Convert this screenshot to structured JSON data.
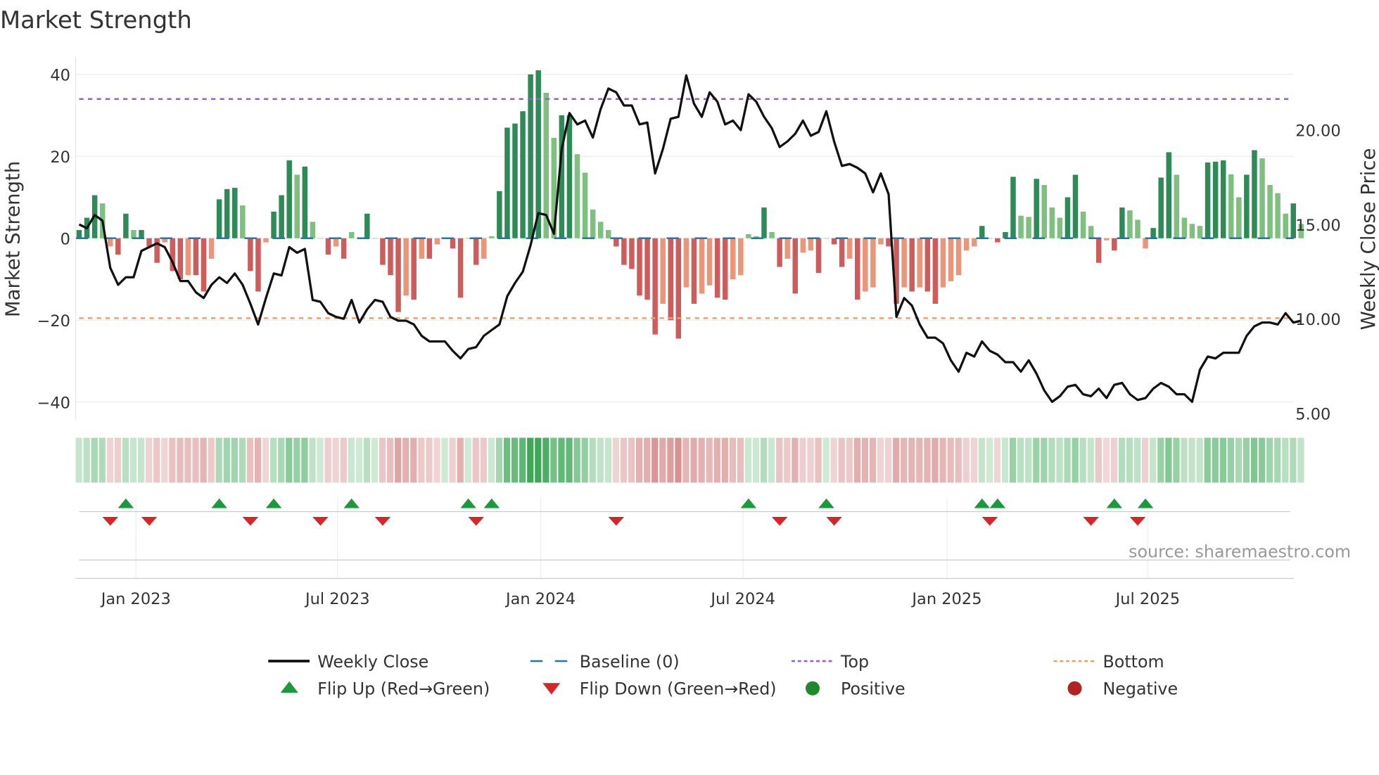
{
  "chart_data": {
    "type": "bar",
    "title": "Market Strength",
    "ylabel": "Market Strength",
    "y2label": "Weekly Close Price",
    "ylim": [
      -44,
      44
    ],
    "y2lim": [
      4.6,
      24.2
    ],
    "yticks": [
      40,
      20,
      0,
      -20,
      -40
    ],
    "ytick_labels": [
      "40",
      "20",
      "0",
      "−20",
      "−40"
    ],
    "y2ticks": [
      20,
      15,
      10,
      5
    ],
    "y2tick_labels": [
      "20.00",
      "15.00",
      "10.00",
      "5.00"
    ],
    "x_unit": "weeks from first bar",
    "xticks": [
      {
        "week": 7.3,
        "label": "Jan 2023"
      },
      {
        "week": 33.2,
        "label": "Jul 2023"
      },
      {
        "week": 59.3,
        "label": "Jan 2024"
      },
      {
        "week": 85.3,
        "label": "Jul 2024"
      },
      {
        "week": 111.5,
        "label": "Jan 2025"
      },
      {
        "week": 137.3,
        "label": "Jul 2025"
      }
    ],
    "top_level": 34,
    "bottom_level": -19.5,
    "baseline": 0,
    "strength": [
      2,
      5,
      10.5,
      8.5,
      -2,
      -4,
      6,
      2,
      2,
      -2,
      -6,
      -1,
      -8,
      -10,
      -9,
      -9,
      -13,
      -5,
      9.5,
      12,
      12.3,
      8,
      -8,
      -13,
      -1,
      6.5,
      10.5,
      19,
      15.5,
      17.5,
      4,
      0,
      -4,
      -2,
      -5,
      1.5,
      0,
      6,
      0,
      -6.5,
      -9,
      -18,
      -14,
      -15,
      -5,
      -5,
      -1.5,
      0,
      -2.5,
      -14.5,
      0,
      -6.5,
      -5,
      0.5,
      11.5,
      27,
      28,
      31,
      40,
      41,
      35.5,
      24.5,
      30,
      30,
      20.5,
      16,
      7,
      4,
      2,
      -2,
      -6.5,
      -7.5,
      -14,
      -15,
      -23.5,
      -16,
      -20,
      -24.5,
      -12,
      -16,
      -13.5,
      -11.5,
      -14.5,
      -15,
      -10,
      -9,
      1,
      0.5,
      7.5,
      1.5,
      -7,
      -5,
      -13.5,
      -3.5,
      -3,
      -8.5,
      0,
      -1.5,
      -7,
      -5,
      -15,
      -13,
      -12,
      -1.5,
      -2,
      -16,
      -12,
      -13,
      -12,
      -13,
      -16,
      -12,
      -10.5,
      -9,
      -3,
      -2,
      3,
      0,
      -1,
      1.5,
      15,
      5.5,
      5.2,
      14.5,
      13,
      7.5,
      5,
      10,
      15.5,
      6.5,
      3,
      -6,
      -0.5,
      -3,
      7.5,
      6.8,
      4.5,
      -2.5,
      2.5,
      14.8,
      21,
      15.5,
      5,
      3.5,
      3,
      18.5,
      18.7,
      19,
      15.6,
      10,
      15.5,
      21.5,
      19.5,
      13,
      11,
      6,
      8.5,
      3.5
    ],
    "weekly_close": [
      15.0,
      14.8,
      15.5,
      15.2,
      12.7,
      11.8,
      12.2,
      12.2,
      13.6,
      13.8,
      14.0,
      13.8,
      13.0,
      12.0,
      12.0,
      11.4,
      11.1,
      11.8,
      12.2,
      11.9,
      12.4,
      11.8,
      10.8,
      9.7,
      11.1,
      12.4,
      12.3,
      13.8,
      13.5,
      13.7,
      11.0,
      10.9,
      10.3,
      10.1,
      10.0,
      11.0,
      9.8,
      10.5,
      11.0,
      10.9,
      10.1,
      9.9,
      9.9,
      9.7,
      9.1,
      8.8,
      8.8,
      8.8,
      8.3,
      7.9,
      8.4,
      8.5,
      9.1,
      9.4,
      9.7,
      11.2,
      11.9,
      12.5,
      13.9,
      15.6,
      15.5,
      14.5,
      19.0,
      20.9,
      20.3,
      20.5,
      19.6,
      21.1,
      22.2,
      22.0,
      21.3,
      21.3,
      20.3,
      20.4,
      17.7,
      19.0,
      20.6,
      20.7,
      22.9,
      21.4,
      20.7,
      22.0,
      21.5,
      20.3,
      20.5,
      20.0,
      21.9,
      21.5,
      20.7,
      20.1,
      19.1,
      19.4,
      19.8,
      20.5,
      19.7,
      19.9,
      21.0,
      19.4,
      18.1,
      18.2,
      18.0,
      17.7,
      16.7,
      17.7,
      16.6,
      10.1,
      11.1,
      10.7,
      9.7,
      9.0,
      9.0,
      8.7,
      7.8,
      7.2,
      8.2,
      8.0,
      8.8,
      8.3,
      8.1,
      7.7,
      7.7,
      7.2,
      7.8,
      7.1,
      6.2,
      5.6,
      5.9,
      6.4,
      6.5,
      6.0,
      5.9,
      6.3,
      5.8,
      6.5,
      6.6,
      6.0,
      5.7,
      5.8,
      6.3,
      6.6,
      6.4,
      6.0,
      6.0,
      5.6,
      7.3,
      8.0,
      7.9,
      8.2,
      8.2,
      8.2,
      9.1,
      9.6,
      9.8,
      9.8,
      9.7,
      10.3,
      9.8,
      9.9
    ],
    "flip_up_weeks": [
      6,
      18,
      25,
      35,
      50,
      53,
      86,
      96,
      116,
      118,
      133,
      137
    ],
    "flip_down_weeks": [
      4,
      9,
      22,
      31,
      39,
      51,
      69,
      90,
      97,
      117,
      130,
      136
    ],
    "legend": [
      {
        "label": "Weekly Close",
        "kind": "line",
        "color": "#111111"
      },
      {
        "label": "Baseline (0)",
        "kind": "dash",
        "color": "#1f77b4"
      },
      {
        "label": "Top",
        "kind": "dot",
        "color": "#9b59e0"
      },
      {
        "label": "Bottom",
        "kind": "dot",
        "color": "#f0a060"
      },
      {
        "label": "Flip Up (Red→Green)",
        "kind": "up",
        "color": "#1a9a3c"
      },
      {
        "label": "Flip Down (Green→Red)",
        "kind": "down",
        "color": "#d62728"
      },
      {
        "label": "Positive",
        "kind": "circle",
        "color": "#1f8a2c"
      },
      {
        "label": "Negative",
        "kind": "circle",
        "color": "#b22222"
      }
    ],
    "legend_placement": "bottom",
    "source": "source: sharemaestro.com",
    "colors": {
      "pos_strong": "#2e8b57",
      "pos_weak": "#7fbf7f",
      "neg_strong": "#cd5c5c",
      "neg_weak": "#e9967a",
      "top": "#9b59e0",
      "bottom": "#f0a060",
      "baseline": "#1f77b4"
    }
  }
}
